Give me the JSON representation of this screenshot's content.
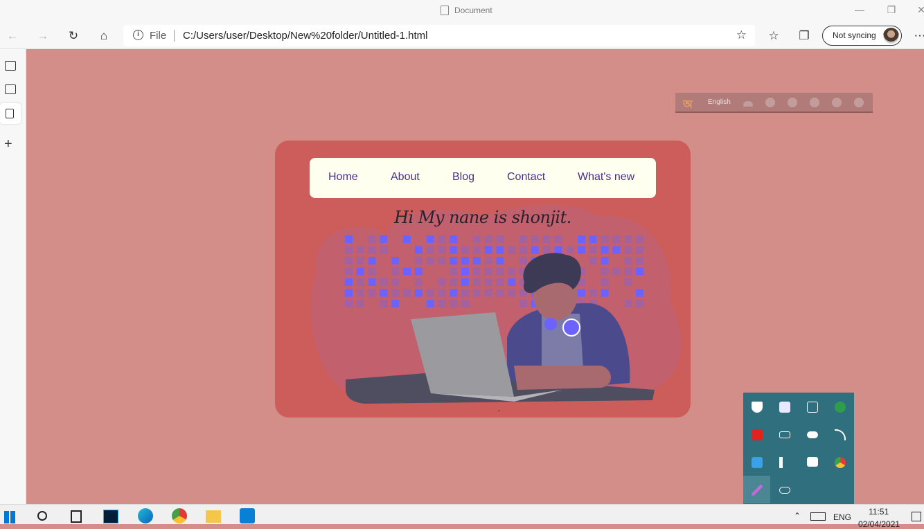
{
  "window": {
    "title": "Document"
  },
  "toolbar": {
    "address_prefix": "File",
    "url": "C:/Users/user/Desktop/New%20folder/Untitled-1.html",
    "profile_label": "Not syncing"
  },
  "language_bar": {
    "language": "English"
  },
  "page": {
    "nav": [
      "Home",
      "About",
      "Blog",
      "Contact",
      "What's new"
    ],
    "greeting": "Hi My nane is shonjit.",
    "dash": "-"
  },
  "taskbar": {
    "language": "ENG",
    "time": "11:51",
    "date": "02/04/2021"
  },
  "colors": {
    "page_bg": "#d38e8a",
    "card_bg": "#cd5d5b",
    "nav_bg": "#fffff0",
    "nav_text": "#4b2c8c",
    "accent_purple": "#6c63ff",
    "tray_bg": "#2f6f7e"
  }
}
